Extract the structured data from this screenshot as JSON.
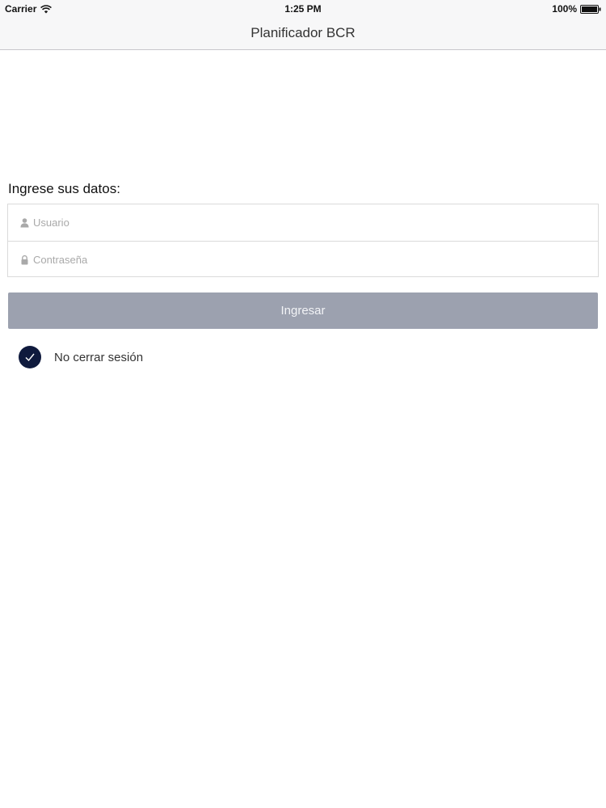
{
  "status_bar": {
    "carrier": "Carrier",
    "time": "1:25 PM",
    "battery": "100%"
  },
  "nav": {
    "title": "Planificador BCR"
  },
  "form": {
    "heading": "Ingrese sus datos:",
    "username_placeholder": "Usuario",
    "password_placeholder": "Contraseña",
    "submit_label": "Ingresar",
    "remember_label": "No cerrar sesión",
    "remember_checked": true
  },
  "icons": {
    "username": "user-icon",
    "password": "lock-icon",
    "remember": "checkmark-icon"
  },
  "colors": {
    "button_bg": "#9ca1af",
    "checkbox_bg": "#0f1a3d",
    "bar_bg": "#f7f7f8"
  }
}
